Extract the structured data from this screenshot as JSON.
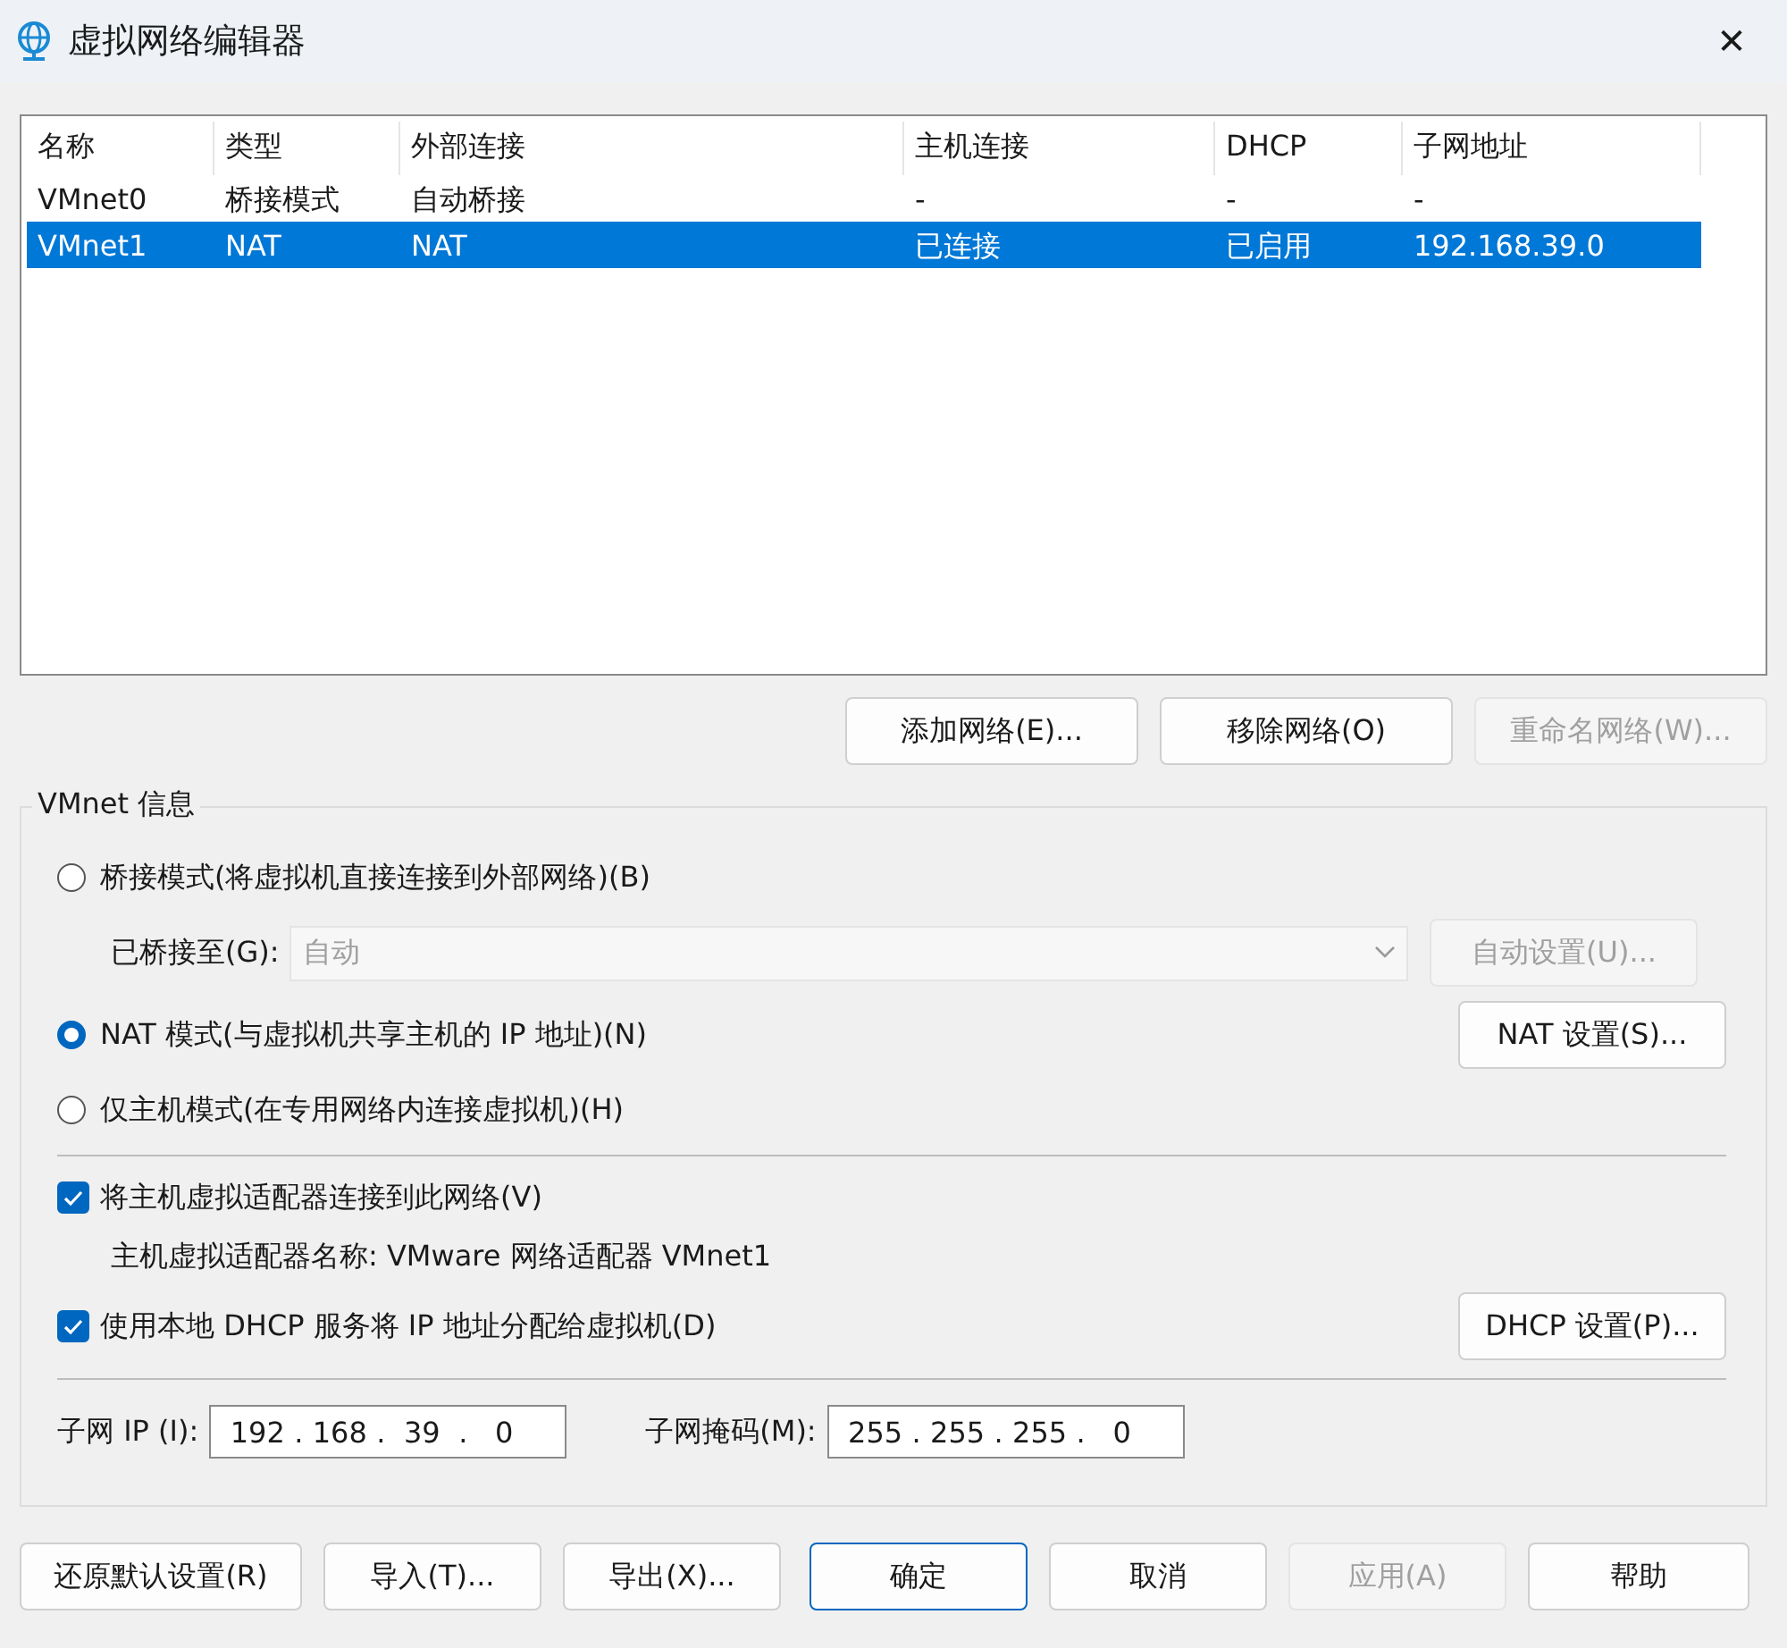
{
  "window": {
    "title": "虚拟网络编辑器",
    "close": "✕"
  },
  "table": {
    "columns": [
      "名称",
      "类型",
      "外部连接",
      "主机连接",
      "DHCP",
      "子网地址"
    ],
    "rows": [
      {
        "cells": [
          "VMnet0",
          "桥接模式",
          "自动桥接",
          "-",
          "-",
          "-"
        ],
        "selected": false
      },
      {
        "cells": [
          "VMnet1",
          "NAT",
          "NAT",
          "已连接",
          "已启用",
          "192.168.39.0"
        ],
        "selected": true
      }
    ]
  },
  "list_buttons": [
    {
      "label": "添加网络(E)...",
      "disabled": false
    },
    {
      "label": "移除网络(O)",
      "disabled": false
    },
    {
      "label": "重命名网络(W)...",
      "disabled": true
    }
  ],
  "vmnet_info": {
    "title": "VMnet 信息",
    "modes": [
      {
        "label": "桥接模式(将虚拟机直接连接到外部网络)(B)",
        "selected": false
      },
      {
        "label": "NAT 模式(与虚拟机共享主机的 IP 地址)(N)",
        "selected": true
      },
      {
        "label": "仅主机模式(在专用网络内连接虚拟机)(H)",
        "selected": false
      }
    ],
    "bridged_to": {
      "label": "已桥接至(G):",
      "value": "自动",
      "disabled": true,
      "button": {
        "label": "自动设置(U)...",
        "disabled": true
      }
    },
    "nat_button": {
      "label": "NAT 设置(S)...",
      "disabled": false
    },
    "connect_adapter": {
      "label": "将主机虚拟适配器连接到此网络(V)",
      "checked": true
    },
    "adapter_name": "主机虚拟适配器名称: VMware 网络适配器 VMnet1",
    "use_dhcp": {
      "label": "使用本地 DHCP 服务将 IP 地址分配给虚拟机(D)",
      "checked": true
    },
    "dhcp_button": {
      "label": "DHCP 设置(P)...",
      "disabled": false
    },
    "subnet_ip": {
      "label": "子网 IP (I):",
      "octets": [
        "192",
        "168",
        "39",
        "0"
      ],
      "separator": "."
    },
    "subnet_mask": {
      "label": "子网掩码(M):",
      "octets": [
        "255",
        "255",
        "255",
        "0"
      ],
      "separator": "."
    }
  },
  "buttons": [
    {
      "label": "还原默认设置(R)",
      "disabled": false,
      "default": false
    },
    {
      "label": "导入(T)...",
      "disabled": false,
      "default": false
    },
    {
      "label": "导出(X)...",
      "disabled": false,
      "default": false
    },
    {
      "label": "确定",
      "disabled": false,
      "default": true
    },
    {
      "label": "取消",
      "disabled": false,
      "default": false
    },
    {
      "label": "应用(A)",
      "disabled": true,
      "default": false
    },
    {
      "label": "帮助",
      "disabled": false,
      "default": false
    }
  ]
}
